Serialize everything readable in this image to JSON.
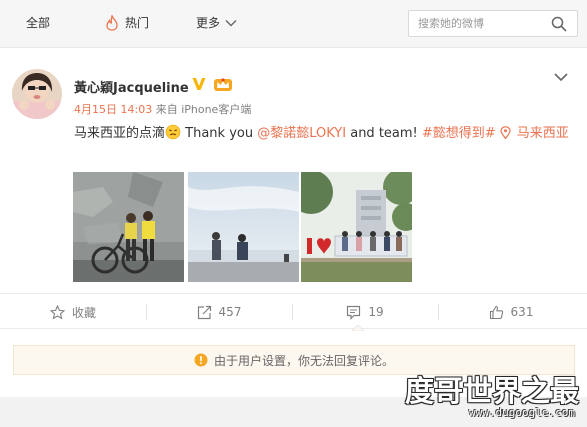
{
  "nav": {
    "all_label": "全部",
    "hot_label": "热门",
    "more_label": "更多",
    "search_placeholder": "搜索她的微博",
    "hot_color": "#eb7350"
  },
  "post": {
    "username": "黃心穎Jacqueline",
    "verified_icon": "verified-v-icon",
    "member_icon": "crown-icon",
    "time": "4月15日 14:03",
    "source": "来自 iPhone客户端",
    "text_lead": "马来西亚的点滴",
    "text_thanks": "Thank you ",
    "mention": "@黎諾懿LOKYI",
    "text_and_team": " and team! ",
    "topic": "#懿想得到#",
    "location": "马来西亚",
    "link_color": "#eb7350",
    "images": [
      {
        "alt": "wall-mural-bicycle-photo"
      },
      {
        "alt": "sea-shore-photo"
      },
      {
        "alt": "i-love-penang-sign-photo"
      }
    ]
  },
  "actions": {
    "favorite_label": "收藏",
    "repost_count": "457",
    "comment_count": "19",
    "like_count": "631"
  },
  "notice": {
    "text": "由于用户设置，你无法回复评论。"
  },
  "watermark": {
    "title": "度哥世界之最",
    "url": "www.dugoogle.com"
  }
}
